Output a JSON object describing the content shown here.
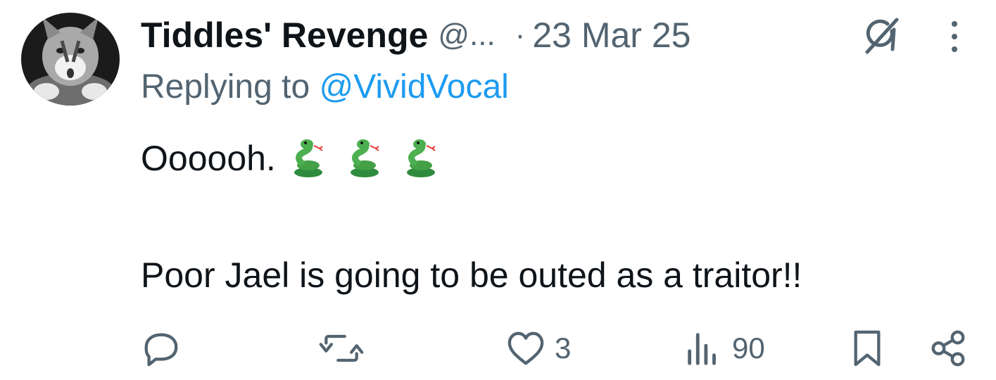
{
  "tweet": {
    "author": {
      "display_name": "Tiddles' Revenge",
      "handle": "@...",
      "avatar_icon": "cat-avatar"
    },
    "separator": "·",
    "date": "23 Mar 25",
    "reply": {
      "prefix": "Replying to ",
      "handle": "@VividVocal"
    },
    "text_line1": "Oooooh.",
    "emojis": [
      "snake-emoji",
      "snake-emoji",
      "snake-emoji"
    ],
    "text_line2": "Poor Jael is going to be outed as a traitor!!",
    "actions": {
      "reply_count": "",
      "repost_count": "",
      "like_count": "3",
      "views_count": "90"
    }
  },
  "colors": {
    "text_primary": "#0f1419",
    "text_secondary": "#536471",
    "link": "#1d9bf0",
    "emoji_green": "#4caf50"
  }
}
